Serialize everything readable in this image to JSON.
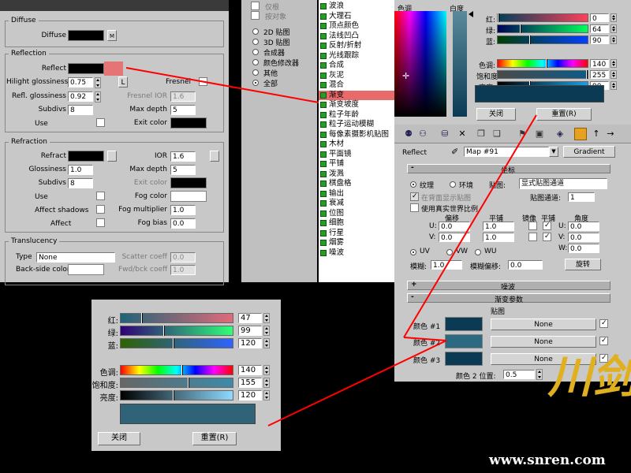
{
  "colors": {
    "accent_red": "#ff0000",
    "highlight": "#e86a6a",
    "dark_teal": "#0b3a55",
    "mid_teal": "#2c6a82"
  },
  "vray": {
    "diffuse": {
      "title": "Diffuse",
      "label": "Diffuse",
      "map_btn": "M"
    },
    "reflection": {
      "title": "Reflection",
      "reflect": "Reflect",
      "hilight_gloss": "Hilight glossiness",
      "hilight_gloss_val": "0.75",
      "lock": "L",
      "fresnel": "Fresnel",
      "refl_gloss": "Refl. glossiness",
      "refl_gloss_val": "0.92",
      "fresnel_ior": "Fresnel IOR",
      "fresnel_ior_val": "1.6",
      "subdivs": "Subdivs",
      "subdivs_val": "8",
      "max_depth": "Max depth",
      "max_depth_val": "5",
      "use": "Use",
      "exit_color": "Exit color"
    },
    "refraction": {
      "title": "Refraction",
      "refract": "Refract",
      "ior": "IOR",
      "ior_val": "1.6",
      "glossiness": "Glossiness",
      "glossiness_val": "1.0",
      "max_depth": "Max depth",
      "max_depth_val": "5",
      "subdivs": "Subdivs",
      "subdivs_val": "8",
      "exit_color": "Exit color",
      "use": "Use",
      "fog_color": "Fog color",
      "affect_shadows": "Affect shadows",
      "fog_multiplier": "Fog multiplier",
      "fog_multiplier_val": "1.0",
      "affect": "Affect",
      "fog_bias": "Fog bias",
      "fog_bias_val": "0.0"
    },
    "translucency": {
      "title": "Translucency",
      "type": "Type",
      "type_val": "None",
      "scatter_coeff": "Scatter coeff",
      "scatter_val": "0.0",
      "backside_color": "Back-side color",
      "fwd_bck": "Fwd/bck coeff",
      "fwd_bck_val": "1.0"
    }
  },
  "browser": {
    "filters": [
      "仅根",
      "按对象"
    ],
    "show": [
      "2D 贴图",
      "3D 贴图",
      "合成器",
      "颜色修改器",
      "其他",
      "全部"
    ],
    "selected_show": 5,
    "maps": [
      "波浪",
      "大理石",
      "顶点颜色",
      "法线凹凸",
      "反射/折射",
      "光线跟踪",
      "合成",
      "灰泥",
      "混合",
      "渐变",
      "渐变坡度",
      "粒子年龄",
      "粒子运动模糊",
      "每像素摄影机贴图",
      "木材",
      "平面镜",
      "平铺",
      "泼溅",
      "棋盘格",
      "输出",
      "衰减",
      "位图",
      "细胞",
      "行星",
      "烟雾",
      "噪波"
    ],
    "selected_map": 9
  },
  "color_picker_top": {
    "hue_label": "色调",
    "white_label": "白度",
    "rows": [
      {
        "label": "红:",
        "value": "0"
      },
      {
        "label": "绿:",
        "value": "64"
      },
      {
        "label": "蓝:",
        "value": "90"
      },
      {
        "label": "色调:",
        "value": "140"
      },
      {
        "label": "饱和度:",
        "value": "255"
      },
      {
        "label": "亮度:",
        "value": "90"
      }
    ],
    "close": "关闭",
    "reset": "重置(R)"
  },
  "material_editor": {
    "slot_name": "Reflect",
    "map_name": "Map #91",
    "map_type": "Gradient",
    "coords": {
      "title": "坐标",
      "texture": "纹理",
      "environ": "环境",
      "mapping_label": "贴图:",
      "mapping_val": "显式贴图通道",
      "show_back": "在背面显示贴图",
      "map_channel": "贴图通道:",
      "map_channel_val": "1",
      "real_world": "使用真实世界比例",
      "col_offset": "偏移",
      "col_tiling": "平铺",
      "col_mirror": "镜像",
      "col_tile": "平铺",
      "col_angle": "角度",
      "u": "U:",
      "v": "V:",
      "w": "W:",
      "u_off": "0.0",
      "u_tile": "1.0",
      "u_ang": "0.0",
      "v_off": "0.0",
      "v_tile": "1.0",
      "v_ang": "0.0",
      "w_ang": "0.0",
      "uv": "UV",
      "vw": "VW",
      "wu": "WU",
      "blur": "模糊:",
      "blur_val": "1.0",
      "blur_offset": "模糊偏移:",
      "blur_offset_val": "0.0",
      "rotate": "旋转"
    },
    "noise": {
      "title": "噪波"
    },
    "gradient": {
      "title": "渐变参数",
      "maps_header": "贴图",
      "color1": "颜色 #1",
      "color2": "颜色 #2",
      "color3": "颜色 #3",
      "none": "None",
      "color2_pos": "颜色 2 位置:",
      "color2_pos_val": "0.5"
    }
  },
  "color_picker_bottom": {
    "rows": [
      {
        "label": "红:",
        "value": "47"
      },
      {
        "label": "绿:",
        "value": "99"
      },
      {
        "label": "蓝:",
        "value": "120"
      },
      {
        "label": "色调:",
        "value": "140"
      },
      {
        "label": "饱和度:",
        "value": "155"
      },
      {
        "label": "亮度:",
        "value": "120"
      }
    ],
    "close": "关闭",
    "reset": "重置(R)"
  },
  "watermark": {
    "site": "www.snren.com",
    "logo_text": "剑川"
  }
}
